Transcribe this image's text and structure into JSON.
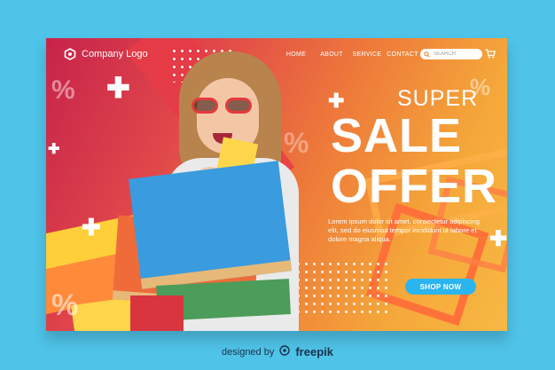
{
  "header": {
    "logo_text": "Company Logo",
    "nav": [
      "HOME",
      "ABOUT",
      "SERVICE",
      "CONTACT"
    ],
    "search_placeholder": "SEARCH"
  },
  "hero": {
    "super": "SUPER",
    "sale": "SALE",
    "offer": "OFFER",
    "body": "Lorem ipsum dolor sit amet, consectetur adipiscing elit, sed do eiusmod tempor incididunt ut labore et dolore magna aliqua.",
    "cta": "SHOP NOW",
    "percent_symbol": "%"
  },
  "icons": {
    "logo": "hexagon-logo-icon",
    "search": "search-icon",
    "cart": "cart-icon"
  },
  "credit": {
    "prefix": "designed by",
    "brand": "freepik"
  },
  "colors": {
    "background": "#4fc3e8",
    "cta": "#2bb5ee",
    "gradient_start": "#c7234a",
    "gradient_end": "#f7b844"
  }
}
